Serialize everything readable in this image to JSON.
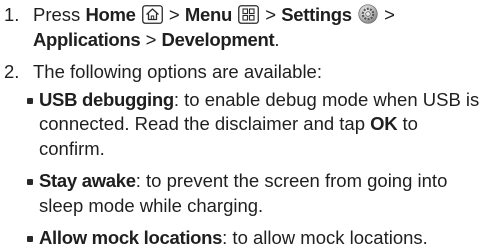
{
  "step1": {
    "number": "1.",
    "press": "Press",
    "home": "Home",
    "sep1": ">",
    "menu": "Menu",
    "sep2": ">",
    "settings": "Settings",
    "sep3": ">",
    "applications": "Applications",
    "sep4": ">",
    "development": "Development",
    "period": "."
  },
  "step2": {
    "number": "2.",
    "intro": "The following options are available:",
    "options": [
      {
        "title": "USB debugging",
        "text_a": ": to enable debug mode when USB is connected. Read the disclaimer and tap ",
        "ok": "OK",
        "text_b": " to confirm."
      },
      {
        "title": "Stay awake",
        "text_a": ": to prevent the screen from going into sleep mode while charging."
      },
      {
        "title": "Allow mock locations",
        "text_a": ": to allow mock locations."
      }
    ]
  },
  "icons": {
    "home": "home-icon",
    "menu": "menu-grid-icon",
    "settings": "settings-gear-icon"
  }
}
